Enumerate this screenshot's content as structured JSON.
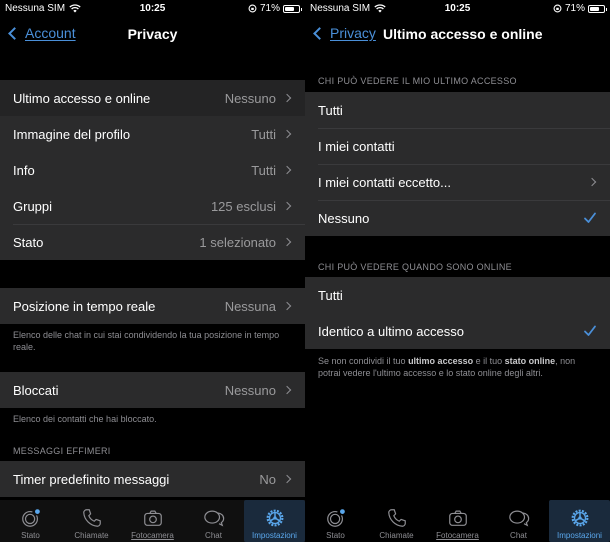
{
  "status_bar": {
    "carrier": "Nessuna SIM",
    "time": "10:25",
    "battery": "71%",
    "battery_level": 0.71
  },
  "left_screen": {
    "back_label": "Account",
    "title": "Privacy",
    "group1": [
      {
        "label": "Ultimo accesso e online",
        "value": "Nessuno"
      },
      {
        "label": "Immagine del profilo",
        "value": "Tutti"
      },
      {
        "label": "Info",
        "value": "Tutti"
      },
      {
        "label": "Gruppi",
        "value": "125 esclusi"
      },
      {
        "label": "Stato",
        "value": "1 selezionato"
      }
    ],
    "live_location": {
      "label": "Posizione in tempo reale",
      "value": "Nessuna"
    },
    "live_location_footnote": "Elenco delle chat in cui stai condividendo la tua posizione in tempo reale.",
    "blocked": {
      "label": "Bloccati",
      "value": "Nessuno"
    },
    "blocked_footnote": "Elenco dei contatti che hai bloccato.",
    "ephemeral_header": "MESSAGGI EFFIMERI",
    "timer": {
      "label": "Timer predefinito messaggi",
      "value": "No"
    }
  },
  "right_screen": {
    "back_label": "Privacy",
    "title": "Ultimo accesso e online",
    "last_seen_header": "CHI PUÒ VEDERE IL MIO ULTIMO ACCESSO",
    "last_seen_options": [
      {
        "label": "Tutti",
        "selected": false,
        "chevron": false
      },
      {
        "label": "I miei contatti",
        "selected": false,
        "chevron": false
      },
      {
        "label": "I miei contatti eccetto...",
        "selected": false,
        "chevron": true
      },
      {
        "label": "Nessuno",
        "selected": true,
        "chevron": false
      }
    ],
    "online_header": "CHI PUÒ VEDERE QUANDO SONO ONLINE",
    "online_options": [
      {
        "label": "Tutti",
        "selected": false
      },
      {
        "label": "Identico a ultimo accesso",
        "selected": true
      }
    ],
    "footnote": {
      "part1": "Se non condividi il tuo ",
      "bold1": "ultimo accesso",
      "part2": " e il tuo ",
      "bold2": "stato online",
      "part3": ", non potrai vedere l'ultimo accesso e lo stato online degli altri."
    }
  },
  "tab_bar": {
    "tabs": [
      {
        "label": "Stato",
        "icon": "status-icon"
      },
      {
        "label": "Chiamate",
        "icon": "phone-icon"
      },
      {
        "label": "Fotocamera",
        "icon": "camera-icon"
      },
      {
        "label": "Chat",
        "icon": "chat-bubbles-icon"
      },
      {
        "label": "Impostazioni",
        "icon": "gear-icon"
      }
    ],
    "active": "Impostazioni"
  },
  "colors": {
    "accent": "#4a8fd8",
    "cell_bg": "#2b2b2c",
    "background": "#000000",
    "secondary_text": "#8e8e93"
  }
}
